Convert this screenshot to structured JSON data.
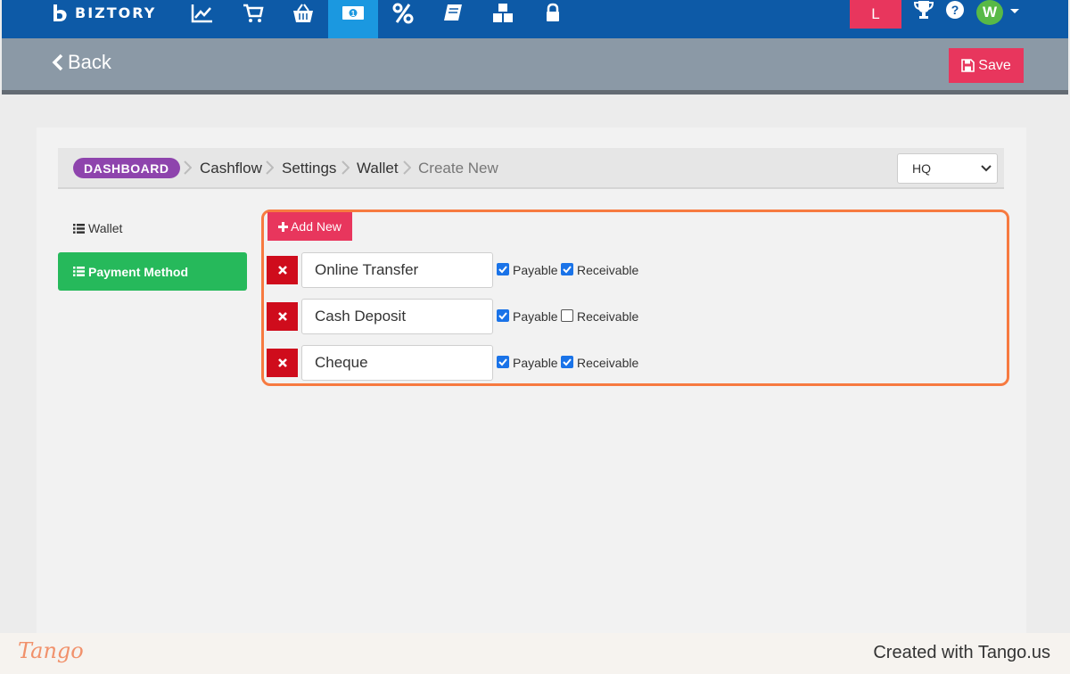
{
  "app": {
    "brand": "BIZTORY"
  },
  "topnav": {
    "icons": [
      "chart-line-icon",
      "cart-icon",
      "basket-icon",
      "money-icon",
      "percent-icon",
      "book-icon",
      "cubes-icon",
      "lock-icon"
    ],
    "active_icon": "money-icon",
    "notification_letter": "L",
    "avatar_letter": "W"
  },
  "header": {
    "back_label": "Back",
    "save_label": "Save"
  },
  "breadcrumb": {
    "items": [
      "DASHBOARD",
      "Cashflow",
      "Settings",
      "Wallet",
      "Create New"
    ]
  },
  "branch_select": {
    "value": "HQ"
  },
  "sidebar": {
    "items": [
      {
        "label": "Wallet",
        "active": false
      },
      {
        "label": "Payment Method",
        "active": true
      }
    ]
  },
  "payment_methods": {
    "add_label": "Add New",
    "payable_label": "Payable",
    "receivable_label": "Receivable",
    "rows": [
      {
        "name": "Online Transfer",
        "payable": true,
        "receivable": true
      },
      {
        "name": "Cash Deposit",
        "payable": true,
        "receivable": false
      },
      {
        "name": "Cheque",
        "payable": true,
        "receivable": true
      }
    ]
  },
  "footer": {
    "logo_text": "Tango",
    "created_text": "Created with Tango.us"
  },
  "colors": {
    "nav_bg": "#0d5aa7",
    "nav_active": "#1b98e0",
    "accent_pink": "#e8365d",
    "success_green": "#26b95b",
    "delete_red": "#cf0c1c",
    "highlight_orange": "#f77a40",
    "dashboard_purple": "#8e44ad"
  }
}
